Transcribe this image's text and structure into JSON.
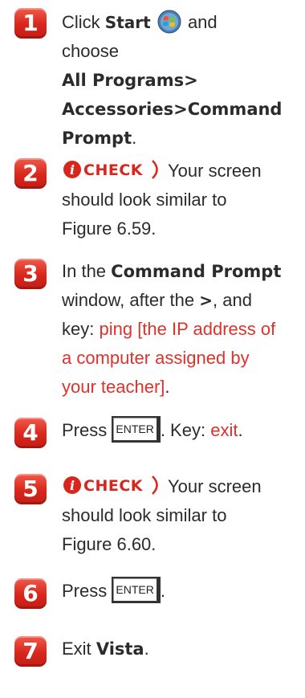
{
  "steps": [
    {
      "number": "1",
      "click": "Click",
      "start": "Start",
      "and": "and",
      "choose": "choose",
      "path1": "All Programs>",
      "path2": "Accessories>Command",
      "path3": "Prompt",
      "period": "."
    },
    {
      "number": "2",
      "check_label": "CHECK",
      "line1": "Your screen",
      "line2": "should look similar to",
      "line3": "Figure 6.59."
    },
    {
      "number": "3",
      "in_the": "In the",
      "command_prompt": "Command Prompt",
      "window_after": "window, after the",
      "gt": ">",
      "and_comma": ", and",
      "key_colon": "key:",
      "red1": "ping [the IP address of",
      "red2": "a computer assigned by",
      "red3": "your teacher]",
      "period": "."
    },
    {
      "number": "4",
      "press": "Press",
      "key_label": "ENTER",
      "key_text": ". Key:",
      "red": "exit",
      "period": "."
    },
    {
      "number": "5",
      "check_label": "CHECK",
      "line1": "Your screen",
      "line2": "should look similar to",
      "line3": "Figure 6.60."
    },
    {
      "number": "6",
      "press": "Press",
      "key_label": "ENTER",
      "period": "."
    },
    {
      "number": "7",
      "exit": "Exit",
      "vista": "Vista",
      "period": "."
    }
  ],
  "colors": {
    "badge": "#d8261c",
    "accent_text": "#e0312b",
    "body_text": "#2b2b2b"
  },
  "icons": [
    "windows-start-orb-icon",
    "check-callout-icon",
    "enter-key-icon"
  ]
}
